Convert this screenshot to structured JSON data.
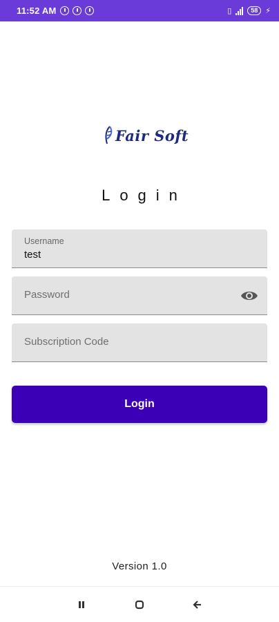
{
  "status_bar": {
    "time": "11:52 AM",
    "battery": "58",
    "icons": [
      "alarm-icon",
      "data-saver-icon",
      "data-saver-icon",
      "no-sim-icon",
      "signal-icon",
      "battery-icon",
      "charging-icon"
    ]
  },
  "brand": {
    "logo_text": "Fair Soft"
  },
  "page": {
    "title": "Login"
  },
  "form": {
    "username": {
      "label": "Username",
      "value": "test"
    },
    "password": {
      "placeholder": "Password",
      "toggle_icon": "eye-icon"
    },
    "subscription": {
      "placeholder": "Subscription Code"
    },
    "submit_label": "Login"
  },
  "footer": {
    "version": "Version 1.0"
  },
  "nav_bar": {
    "buttons": [
      "recent-apps-icon",
      "home-icon",
      "back-icon"
    ]
  },
  "colors": {
    "status_bar": "#6a3bd8",
    "primary_button": "#3b00b5",
    "field_bg": "#e3e3e3",
    "logo": "#1f2a7a"
  }
}
